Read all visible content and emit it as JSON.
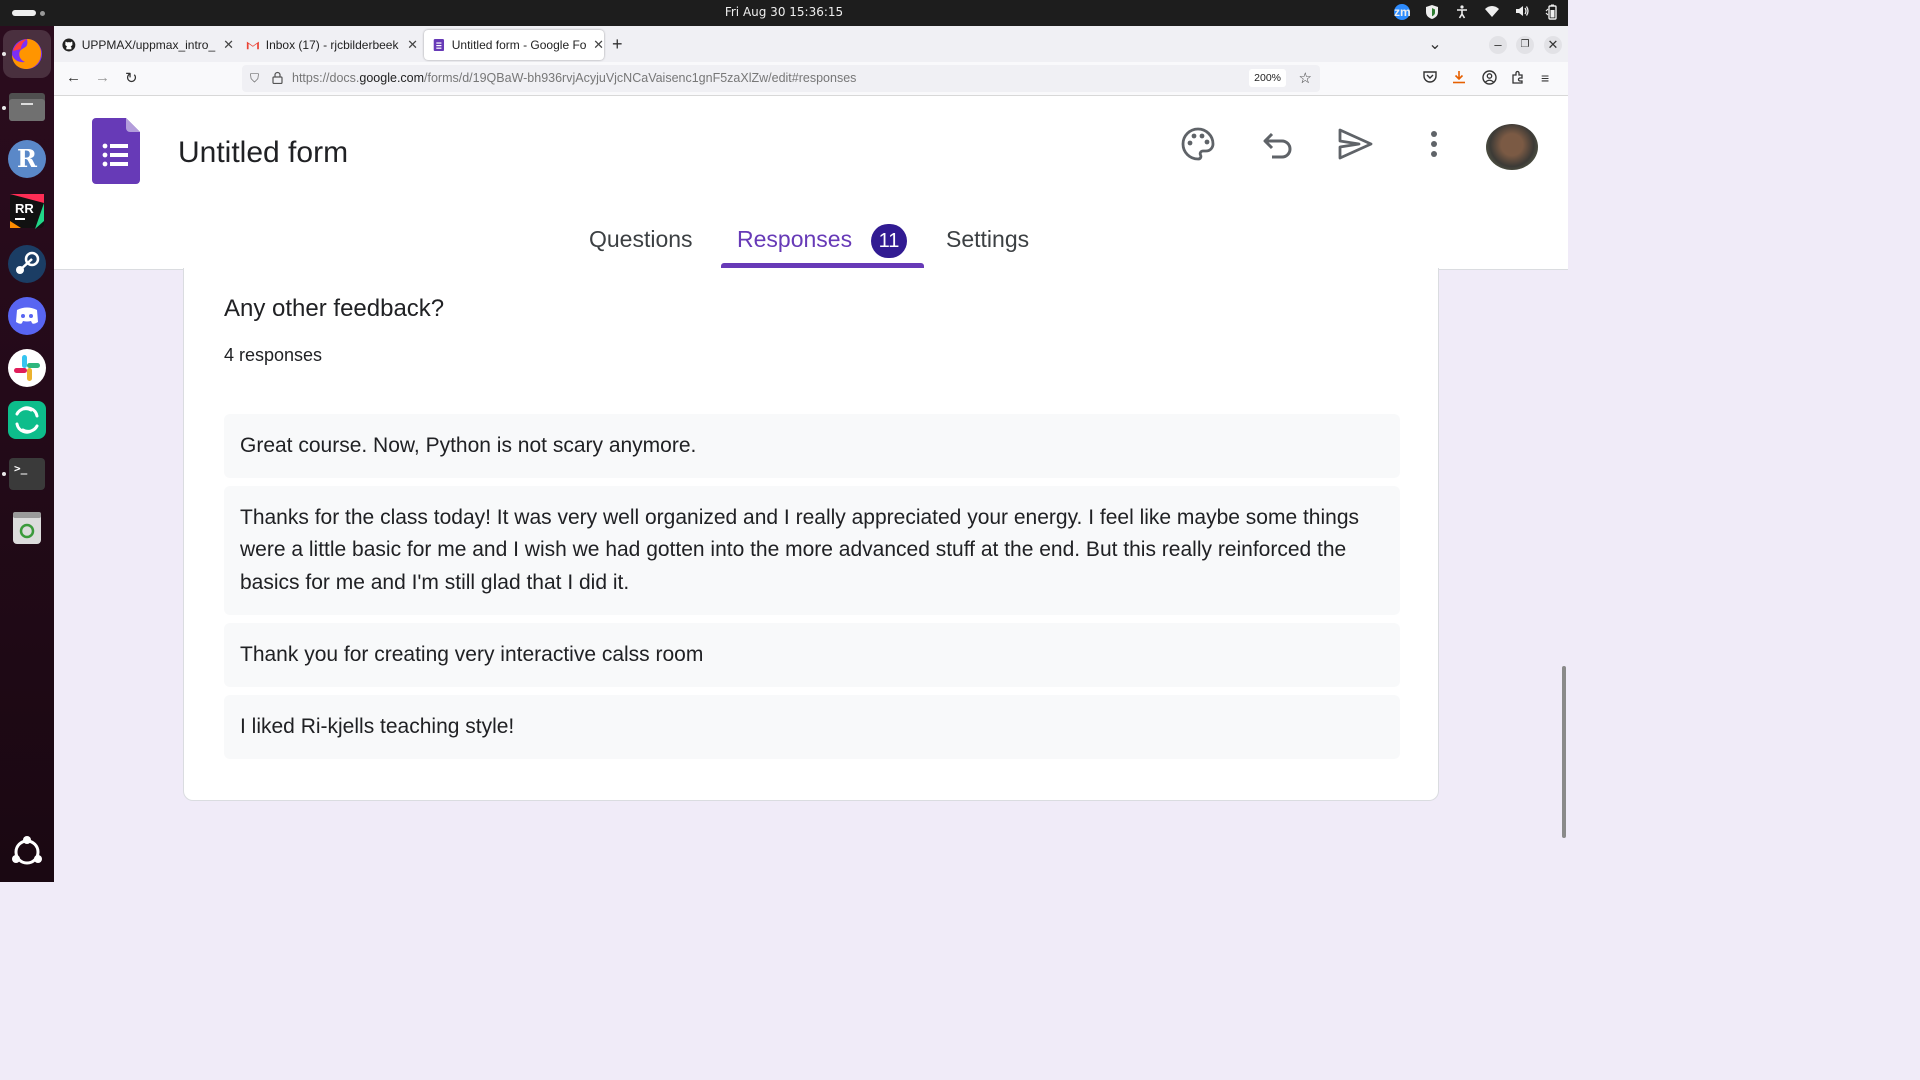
{
  "system": {
    "clock": "Fri Aug 30  15:36:15",
    "tray_icons": [
      "zoom-icon",
      "shield-icon",
      "accessibility-icon",
      "wifi-icon",
      "volume-icon",
      "battery-icon"
    ]
  },
  "dock": {
    "apps": [
      "firefox",
      "files",
      "r",
      "rstudio",
      "steam",
      "discord",
      "slack",
      "element",
      "terminal",
      "trash",
      "ubuntu-apps"
    ]
  },
  "browser": {
    "tabs": [
      {
        "label": "UPPMAX/uppmax_intro_",
        "icon": "github-icon"
      },
      {
        "label": "Inbox (17) - rjcbilderbeek",
        "icon": "gmail-icon"
      },
      {
        "label": "Untitled form - Google Fo",
        "icon": "forms-icon",
        "active": true
      }
    ],
    "url_prefix": "https://docs.",
    "url_domain": "google.com",
    "url_suffix": "/forms/d/19QBaW-bh936rvjAcyjuVjcNCaVaisenc1gnF5zaXlZw/edit#responses",
    "zoom": "200%"
  },
  "form": {
    "title": "Untitled form",
    "tabs": {
      "questions": "Questions",
      "responses": "Responses",
      "responses_count": "11",
      "settings": "Settings"
    },
    "question": {
      "title": "Any other feedback?",
      "count": "4 responses",
      "responses": [
        "Great course. Now, Python is not scary anymore.",
        "Thanks for the class today! It was very well organized and I really appreciated your energy. I feel like maybe some things were a little basic for me and I wish we had gotten into the more advanced stuff at the end. But this really reinforced the basics for me and I'm still glad that I did it.",
        "Thank you for creating very interactive calss room",
        "I liked Ri-kjells teaching style!"
      ]
    }
  },
  "colors": {
    "accent": "#673ab7",
    "badge": "#311b92",
    "page_bg": "#f0ebf8"
  }
}
